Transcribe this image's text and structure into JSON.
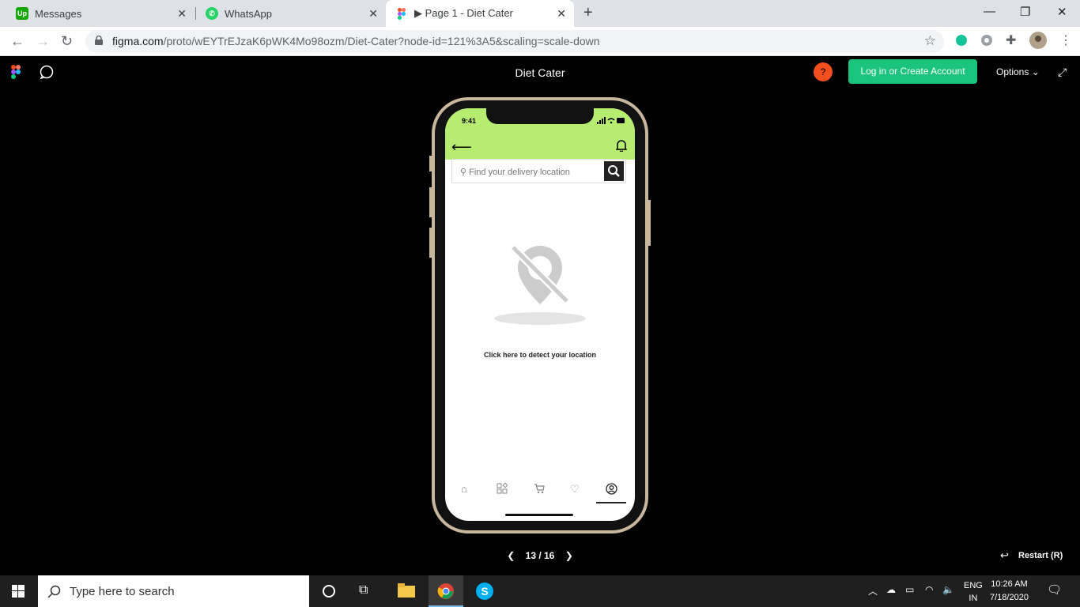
{
  "browser": {
    "tabs": [
      {
        "label": "Messages",
        "icon": "upwork-icon"
      },
      {
        "label": "WhatsApp",
        "icon": "whatsapp-icon"
      },
      {
        "label": "▶ Page 1 - Diet Cater",
        "icon": "figma-icon"
      }
    ],
    "url_host": "figma.com",
    "url_path": "/proto/wEYTrEJzaK6pWK4Mo98ozm/Diet-Cater?node-id=121%3A5&scaling=scale-down"
  },
  "figma": {
    "title": "Diet Cater",
    "help_label": "?",
    "login_label": "Log in or Create Account",
    "options_label": "Options ⌄",
    "pager": "13 / 16",
    "restart_label": "Restart (R)"
  },
  "app": {
    "time": "9:41",
    "search_placeholder": "Find your delivery location",
    "detect_label": "Click here to detect your location",
    "accent": "#b6ec6f"
  },
  "taskbar": {
    "search_placeholder": "Type here to search",
    "lang": "ENG",
    "region": "IN",
    "time": "10:26 AM",
    "date": "7/18/2020"
  }
}
